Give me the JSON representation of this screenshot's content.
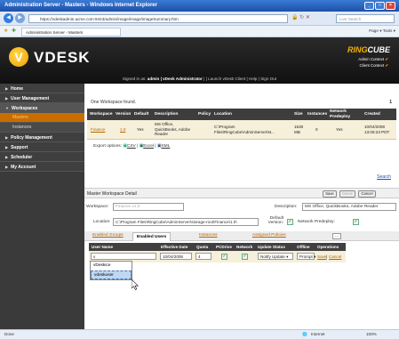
{
  "window": {
    "title": "Administration Server - Masters - Windows Internet Explorer"
  },
  "browser": {
    "url": "https://vdeskadmin.acme.com:9443/admin/image/image/imageSummary.htm",
    "search_placeholder": "Live Search",
    "tab_label": "Administration Server - Masters",
    "tools": "Page ▾  Tools ▾"
  },
  "header": {
    "logo_letter": "V",
    "logo_text": "VDESK",
    "brand_left": "RING",
    "brand_right": "CUBE",
    "admin_context": "Admin Context",
    "client_context": "Client Context",
    "signed_in_prefix": "Signed in as:",
    "signed_in_user": "admin | vDesk Administrator",
    "links": "| | Launch vDesk Client | Help | Sign Out"
  },
  "sidebar": {
    "home": "Home",
    "user_management": "User Management",
    "workspaces": "Workspaces",
    "masters": "Masters",
    "instances": "Instances",
    "policy_management": "Policy Management",
    "support": "Support",
    "scheduler": "Scheduler",
    "my_account": "My Account"
  },
  "workspaces": {
    "found_text": "One Workspace found.",
    "page": "1",
    "columns": [
      "Workspace",
      "Version",
      "Default",
      "Description",
      "Policy",
      "Location",
      "Size",
      "Instances",
      "Network Predeploy",
      "Created"
    ],
    "row": {
      "workspace": "Finance",
      "version": "1.0",
      "default": "Yes",
      "description": "MS Office, QuickBooks, Adobe Reader",
      "policy": "",
      "location": "C:\\Program Files\\RingCube\\AdminServer\\st...",
      "size": "1530 MB",
      "instances": "0",
      "predeploy": "Yes",
      "created": "10/04/2008 13:06:23 PDT"
    },
    "export_label": "Export options:",
    "export_csv": "CSV",
    "export_excel": "Excel",
    "export_xml": "XML",
    "search_link": "Search"
  },
  "detail": {
    "title": "Master Workspace Detail",
    "save": "Save",
    "delete": "Delete",
    "cancel": "Cancel",
    "workspace_label": "Workspace:",
    "workspace_value": "Finance v1.0",
    "description_label": "Description:",
    "description_value": "MS Office, QuickBooks, Adobe Reader",
    "location_label": "Location:",
    "location_value": "C:\\Program Files\\RingCube\\AdminServer\\storage-root\\Finance\\1.0\\",
    "default_version_label": "Default Version:",
    "network_predeploy_label": "Network Predeploy:"
  },
  "subtabs": {
    "enabled_groups": "Enabled Groups",
    "enabled_users": "Enabled Users",
    "instances": "Instances",
    "assigned_policies": "Assigned Policies",
    "more": "..."
  },
  "users": {
    "columns": [
      "User Name",
      "Effective Date",
      "Quota",
      "PCDrive",
      "Network",
      "Update Status",
      "Offline",
      "Operations"
    ],
    "row": {
      "username": "v",
      "effective_date": "10/04/2008",
      "quota": "4",
      "update_status": "Notify Update ▾",
      "offline": "Prompt ▾",
      "save": "Save",
      "cancel": "Cancel"
    },
    "suggestions": [
      "vDeskice",
      "vdeskuser"
    ]
  },
  "status": {
    "left": "Done",
    "zone": "Internet",
    "zoom": "100%"
  }
}
